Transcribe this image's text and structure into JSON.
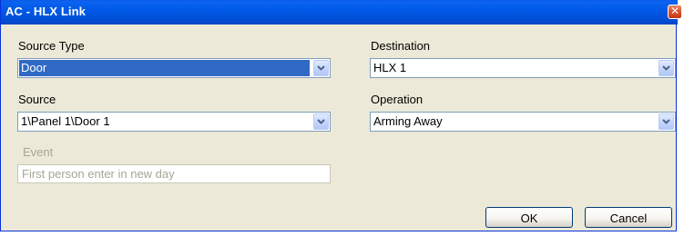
{
  "window": {
    "title": "AC - HLX Link"
  },
  "source_type": {
    "label": "Source Type",
    "value": "Door"
  },
  "source": {
    "label": "Source",
    "value": "1\\Panel 1\\Door 1"
  },
  "event": {
    "label": "Event",
    "placeholder": "First person enter in new day"
  },
  "destination": {
    "label": "Destination",
    "value": "HLX 1"
  },
  "operation": {
    "label": "Operation",
    "value": "Arming Away"
  },
  "buttons": {
    "ok": "OK",
    "cancel": "Cancel"
  },
  "icons": {
    "close": "close-icon",
    "dropdown": "chevron-down-icon"
  },
  "colors": {
    "titlebar": "#0058e6",
    "dialog_bg": "#ece9d8",
    "selection": "#316ac5",
    "close": "#d9512b"
  }
}
